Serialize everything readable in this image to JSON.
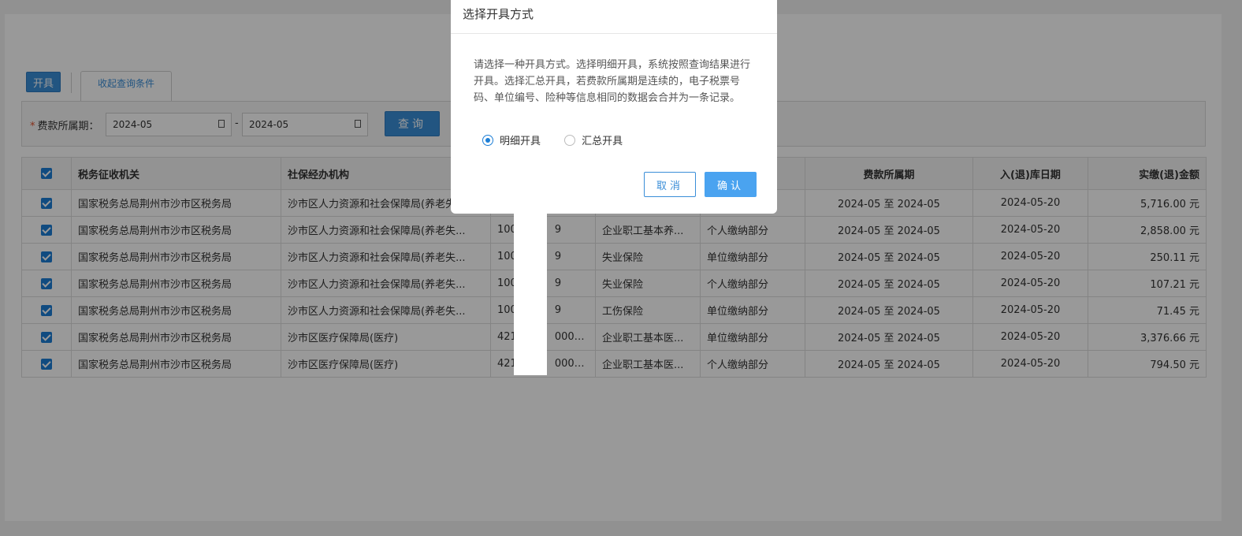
{
  "toolbar": {
    "issue_label": "开具",
    "collapse_tab": "收起查询条件"
  },
  "query": {
    "required_mark": "*",
    "period_label": "费款所属期：",
    "start_value": "2024-05",
    "end_value": "2024-05",
    "separator": "-",
    "query_button": "查询"
  },
  "table": {
    "headers": [
      "税务征收机关",
      "社保经办机构",
      "",
      "",
      "",
      "费款所属期",
      "入(退)库日期",
      "实缴(退)金额"
    ],
    "rows": [
      [
        "国家税务总局荆州市沙市区税务局",
        "沙市区人力资源和社会保障局(养老失...",
        "",
        "",
        "",
        "2024-05 至 2024-05",
        "2024-05-20",
        "5,716.00 元"
      ],
      [
        "国家税务总局荆州市沙市区税务局",
        "沙市区人力资源和社会保障局(养老失...",
        "100",
        "企业职工基本养...",
        "个人缴纳部分",
        "2024-05 至 2024-05",
        "2024-05-20",
        "2,858.00 元"
      ],
      [
        "国家税务总局荆州市沙市区税务局",
        "沙市区人力资源和社会保障局(养老失...",
        "100",
        "失业保险",
        "单位缴纳部分",
        "2024-05 至 2024-05",
        "2024-05-20",
        "250.11 元"
      ],
      [
        "国家税务总局荆州市沙市区税务局",
        "沙市区人力资源和社会保障局(养老失...",
        "100",
        "失业保险",
        "个人缴纳部分",
        "2024-05 至 2024-05",
        "2024-05-20",
        "107.21 元"
      ],
      [
        "国家税务总局荆州市沙市区税务局",
        "沙市区人力资源和社会保障局(养老失...",
        "100",
        "工伤保险",
        "单位缴纳部分",
        "2024-05 至 2024-05",
        "2024-05-20",
        "71.45 元"
      ],
      [
        "国家税务总局荆州市沙市区税务局",
        "沙市区医疗保障局(医疗)",
        "421",
        "企业职工基本医...",
        "单位缴纳部分",
        "2024-05 至 2024-05",
        "2024-05-20",
        "3,376.66 元"
      ],
      [
        "国家税务总局荆州市沙市区税务局",
        "沙市区医疗保障局(医疗)",
        "421",
        "企业职工基本医...",
        "个人缴纳部分",
        "2024-05 至 2024-05",
        "2024-05-20",
        "794.50 元"
      ]
    ],
    "partial_suffixes": [
      "",
      "9",
      "9",
      "9",
      "9",
      "00000...",
      "00000..."
    ]
  },
  "dialog": {
    "title": "选择开具方式",
    "message": "请选择一种开具方式。选择明细开具，系统按照查询结果进行开具。选择汇总开具，若费款所属期是连续的，电子税票号码、单位编号、险种等信息相同的数据会合并为一条记录。",
    "options": [
      "明细开具",
      "汇总开具"
    ],
    "selected": "明细开具",
    "cancel_label": "取消",
    "ok_label": "确认"
  },
  "colors": {
    "primary": "#3a8ed8",
    "checkbox": "#1c7ed6",
    "required": "#e0502c"
  }
}
